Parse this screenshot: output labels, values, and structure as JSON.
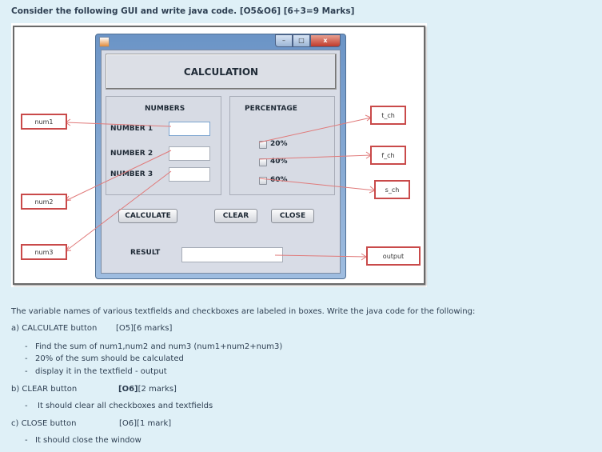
{
  "question": {
    "title": "Consider the following GUI and write java code.   [O5&O6] [6+3=9 Marks]"
  },
  "gui": {
    "window_title": "",
    "window_controls": {
      "minimize": "–",
      "maximize": "□",
      "close": "x"
    },
    "banner": "CALCULATION",
    "numbers_panel": {
      "heading": "NUMBERS",
      "fields": [
        {
          "label": "NUMBER 1",
          "value": ""
        },
        {
          "label": "NUMBER 2",
          "value": ""
        },
        {
          "label": "NUMBER 3",
          "value": ""
        }
      ]
    },
    "percentage_panel": {
      "heading": "PERCENTAGE",
      "checkboxes": [
        {
          "label": "20%",
          "checked": false
        },
        {
          "label": "40%",
          "checked": false
        },
        {
          "label": "60%",
          "checked": false
        }
      ]
    },
    "buttons": {
      "calculate": "CALCULATE",
      "clear": "CLEAR",
      "close": "CLOSE"
    },
    "result": {
      "label": "RESULT",
      "value": ""
    }
  },
  "annotations": {
    "num1": "num1",
    "num2": "num2",
    "num3": "num3",
    "t_ch": "t_ch",
    "f_ch": "f_ch",
    "s_ch": "s_ch",
    "output": "output",
    "color": "#c94a4a"
  },
  "instructions": {
    "intro": "The variable names of various textfields and checkboxes are labeled in boxes. Write the java code for the following:",
    "a": {
      "title": "a) CALCULATE button",
      "marks": "[O5][6 marks]",
      "bullets": [
        "Find the sum of num1,num2 and num3 (num1+num2+num3)",
        "20% of the sum should be calculated",
        "display it in the textfield - output"
      ]
    },
    "b": {
      "title": "b) CLEAR button",
      "marks_bold": "[O6]",
      "marks": "[2 marks]",
      "bullets": [
        "It should clear all checkboxes and textfields"
      ]
    },
    "c": {
      "title": "c) CLOSE button",
      "marks": "[O6][1 mark]",
      "bullets": [
        "It should close the window"
      ]
    },
    "dash": "-"
  }
}
